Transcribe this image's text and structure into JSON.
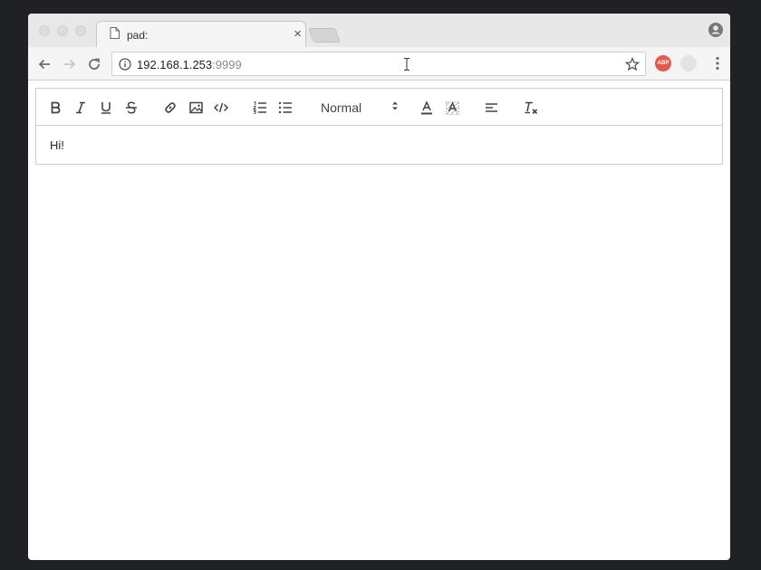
{
  "browser": {
    "tab": {
      "title": "pad:"
    },
    "address": {
      "host": "192.168.1.253",
      "port": ":9999"
    },
    "extensions": {
      "abp_label": "ABP"
    }
  },
  "editor": {
    "header_picker": {
      "value": "Normal"
    },
    "content": {
      "text": "Hi!"
    }
  },
  "icons": [
    "page-icon",
    "close-icon",
    "profile-icon",
    "back-arrow-icon",
    "forward-arrow-icon",
    "reload-icon",
    "info-icon",
    "star-icon",
    "menu-dots-icon",
    "bold-icon",
    "italic-icon",
    "underline-icon",
    "strike-icon",
    "link-icon",
    "image-icon",
    "code-icon",
    "ordered-list-icon",
    "bullet-list-icon",
    "text-color-icon",
    "background-color-icon",
    "align-left-icon",
    "clear-format-icon"
  ]
}
